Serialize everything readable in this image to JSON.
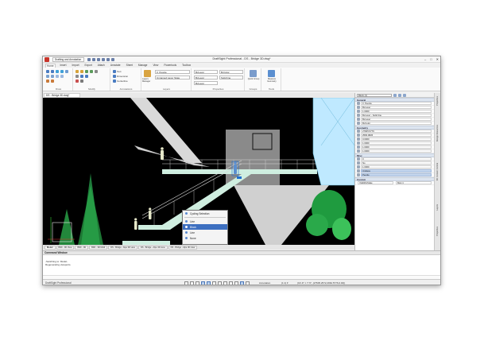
{
  "window": {
    "title": "DraftSight Professional - DS - Bridge 3D.dwg*",
    "workspace": "Drafting and Annotation",
    "controls": [
      "–",
      "□",
      "✕"
    ]
  },
  "ribbon_tabs": [
    "Home",
    "Insert",
    "Import",
    "Export",
    "Attach",
    "Annotate",
    "Sheet",
    "Manage",
    "View",
    "Powertools",
    "Toolbox"
  ],
  "ribbon_active_tab": "Home",
  "ribbon": {
    "groups": [
      "Draw",
      "Modify",
      "Annotations",
      "Layers",
      "Properties",
      "Groups",
      "Tools"
    ],
    "annotations": {
      "text": "Text",
      "dimension": "Dimension",
      "centerline": "Centerline"
    },
    "layers": {
      "manager_label": "Layers Manager",
      "layer_combo": "0_People",
      "layer_combo2": "Unnamed Layer State"
    },
    "properties": {
      "color_combo": "ByLayer",
      "linetype_combo": "ByLayer",
      "lineweight_combo": "ByLayer",
      "line_style": "Solid line",
      "color_alt": "ByColor"
    },
    "groups_btn": "Quick Group",
    "tools_btn": "Measure Geometry"
  },
  "document_tab": "DS - Bridge 3D.dwg*",
  "context_menu": {
    "items": [
      {
        "label": "Cycling Selection",
        "selected": false
      },
      {
        "label": "Line",
        "selected": false
      },
      {
        "label": "Block",
        "selected": true
      },
      {
        "label": "Line",
        "selected": false
      },
      {
        "label": "None",
        "selected": false
      }
    ]
  },
  "layout_tabs": [
    "Model",
    "B3D - 3D View",
    "B3D - 3D",
    "B3D - 3D Mold",
    "DS - Bridge - Alpe 3D view",
    "DS - Bridge - Alpe 3D view",
    "DS - Bridge - Alpe 3D view"
  ],
  "layout_active": "Model",
  "command_window": {
    "title": "Command Window",
    "lines": [
      "-Switching to: Model-",
      "Regenerating viewports."
    ]
  },
  "status_bar": {
    "app_name": "DraftSight Professional",
    "annotation": "Annotation",
    "scale": "(1:1) ▾",
    "coords": "(19'-9\" × 7'-5\", (27505.2572,2962.5776,0.00))"
  },
  "properties_panel": {
    "selector": "Block (1)",
    "general_title": "General",
    "general_values": [
      "0_People",
      "ByLayer",
      "1.0000",
      "ByLayer - Solid line",
      "ByLayer",
      "ByColor"
    ],
    "geometry_title": "Geometry",
    "geometry_values": [
      "27905.5776",
      "2584.9826",
      "0.0000",
      "1.0000",
      "1.0000",
      "1.0000"
    ],
    "misc_title": "Misc",
    "misc_values": [
      "0",
      "No",
      "1.0000",
      "Unitless",
      "People"
    ],
    "misc_selected": [
      false,
      false,
      false,
      true,
      true
    ],
    "custom_title": "Custom",
    "custom_values": [
      "VisibilityState",
      "Man 1"
    ],
    "side_labels": [
      "Properties",
      "Design Resources",
      "3D Content Central",
      "Layers",
      "Properties"
    ]
  },
  "colors": {
    "stair": "#cfeee0",
    "railing": "#d8d8d8",
    "tree": "#2aa94a",
    "person": "#e6e8c9",
    "glass": "#bfe9ff",
    "selection": "#3d6fc0"
  }
}
